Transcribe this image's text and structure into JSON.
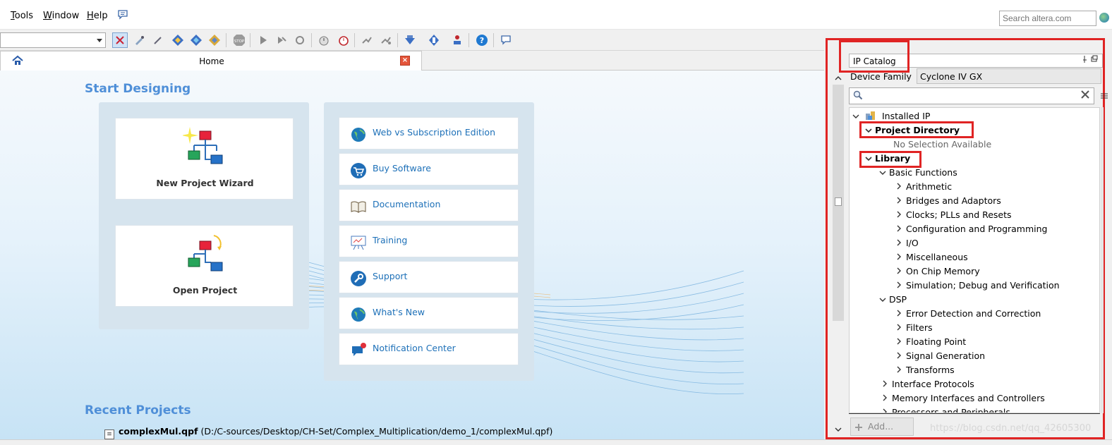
{
  "menu": {
    "items": [
      {
        "label": "Tools",
        "accel": "T",
        "rest": "ools"
      },
      {
        "label": "Window",
        "accel": "W",
        "rest": "indow"
      },
      {
        "label": "Help",
        "accel": "H",
        "rest": "elp"
      }
    ],
    "search_placeholder": "Search altera.com"
  },
  "tabs": {
    "home_label": "Home",
    "close_glyph": "×"
  },
  "home": {
    "start_title": "Start Designing",
    "new_project": "New Project Wizard",
    "open_project": "Open Project",
    "links": [
      "Web vs Subscription Edition",
      "Buy Software",
      "Documentation",
      "Training",
      "Support",
      "What's New",
      "Notification Center"
    ],
    "recent_title": "Recent Projects",
    "recent_name": "complexMul.qpf",
    "recent_path": "(D:/C-sources/Desktop/CH-Set/Complex_Multiplication/demo_1/complexMul.qpf)"
  },
  "ip_catalog": {
    "title": "IP Catalog",
    "device_family_label": "Device Family",
    "device_family_value": "Cyclone IV GX",
    "tree": {
      "installed": "Installed IP",
      "project_directory": "Project Directory",
      "no_selection": "No Selection Available",
      "library": "Library",
      "basic_functions": "Basic Functions",
      "basic_children": [
        "Arithmetic",
        "Bridges and Adaptors",
        "Clocks; PLLs and Resets",
        "Configuration and Programming",
        "I/O",
        "Miscellaneous",
        "On Chip Memory",
        "Simulation; Debug and Verification"
      ],
      "dsp": "DSP",
      "dsp_children": [
        "Error Detection and Correction",
        "Filters",
        "Floating Point",
        "Signal Generation",
        "Transforms"
      ],
      "more": [
        "Interface Protocols",
        "Memory Interfaces and Controllers",
        "Processors and Peripherals"
      ]
    },
    "add_label": "Add...",
    "watermark": "https://blog.csdn.net/qq_42605300"
  }
}
